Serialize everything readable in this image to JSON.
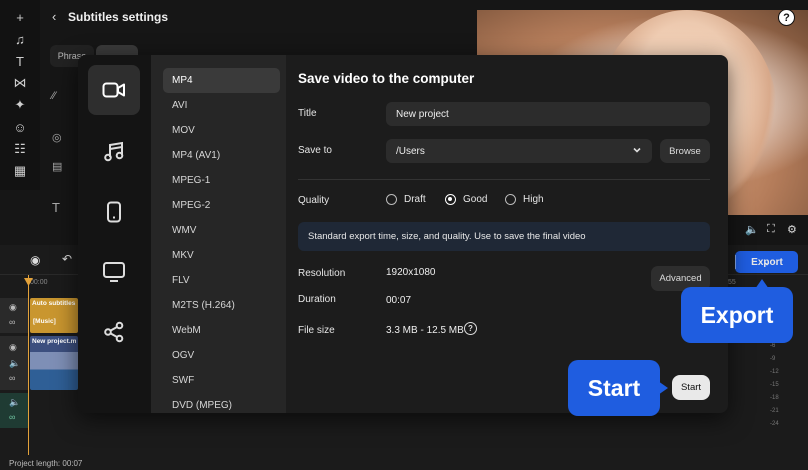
{
  "editor": {
    "panel_title": "Subtitles settings",
    "tab_phrase": "Phrase",
    "export_label": "Export",
    "project_length": "Project length: 00:07",
    "ruler_start": "00:00",
    "ruler_mark": "55",
    "tracks": {
      "auto_subtitles": "Auto subtitles",
      "music": "[Music]",
      "new_project": "New project.m"
    },
    "meter_ticks": [
      "-3",
      "-6",
      "-9",
      "-12",
      "-15",
      "-18",
      "-21",
      "-24"
    ]
  },
  "dialog": {
    "title": "Save video to the computer",
    "categories": [
      {
        "name": "video",
        "icon": "video-camera-icon",
        "active": true
      },
      {
        "name": "audio",
        "icon": "music-note-icon",
        "active": false
      },
      {
        "name": "mobile",
        "icon": "smartphone-icon",
        "active": false
      },
      {
        "name": "tv",
        "icon": "tv-icon",
        "active": false
      },
      {
        "name": "share",
        "icon": "share-icon",
        "active": false
      }
    ],
    "formats": [
      "MP4",
      "AVI",
      "MOV",
      "MP4 (AV1)",
      "MPEG-1",
      "MPEG-2",
      "WMV",
      "MKV",
      "FLV",
      "M2TS (H.264)",
      "WebM",
      "OGV",
      "SWF",
      "DVD (MPEG)"
    ],
    "selected_format": "MP4",
    "title_label": "Title",
    "title_value": "New project",
    "save_to_label": "Save to",
    "save_to_value": "/Users",
    "browse_label": "Browse",
    "quality_label": "Quality",
    "quality_options": [
      "Draft",
      "Good",
      "High"
    ],
    "quality_selected": "Good",
    "quality_info": "Standard export time, size, and quality. Use to save the final video",
    "resolution_label": "Resolution",
    "resolution_value": "1920x1080",
    "duration_label": "Duration",
    "duration_value": "00:07",
    "file_size_label": "File size",
    "file_size_value": "3.3 MB - 12.5 MB",
    "advanced_label": "Advanced",
    "start_label": "Start"
  },
  "callouts": {
    "export": "Export",
    "start": "Start"
  },
  "colors": {
    "accent": "#1f5de0",
    "dialog_bg": "#1c1c1c",
    "playhead": "#e3a23a",
    "subtitle_clip": "#c9962f",
    "video_clip": "#3c4f7f"
  }
}
